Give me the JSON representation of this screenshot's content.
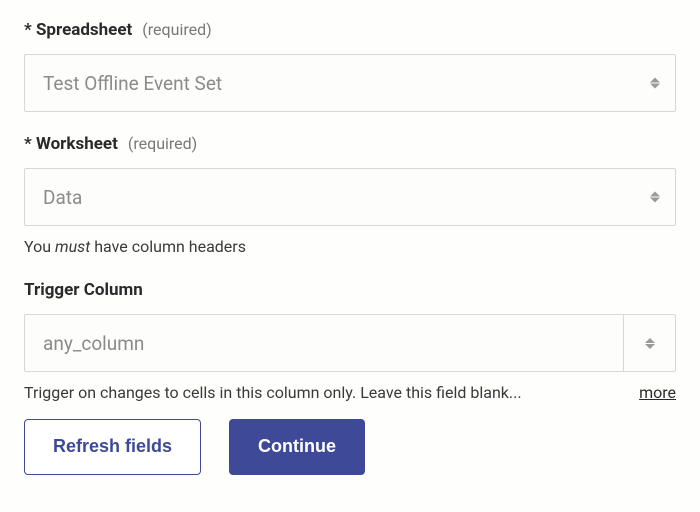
{
  "fields": {
    "spreadsheet": {
      "asterisk": "*",
      "label": "Spreadsheet",
      "required_tag": "(required)",
      "value": "Test Offline Event Set"
    },
    "worksheet": {
      "asterisk": "*",
      "label": "Worksheet",
      "required_tag": "(required)",
      "value": "Data",
      "help_prefix": "You ",
      "help_emph": "must",
      "help_suffix": " have column headers"
    },
    "trigger_column": {
      "label": "Trigger Column",
      "value": "any_column",
      "help": "Trigger on changes to cells in this column only. Leave this field blank...",
      "more": "more"
    }
  },
  "buttons": {
    "refresh": "Refresh fields",
    "continue": "Continue"
  }
}
